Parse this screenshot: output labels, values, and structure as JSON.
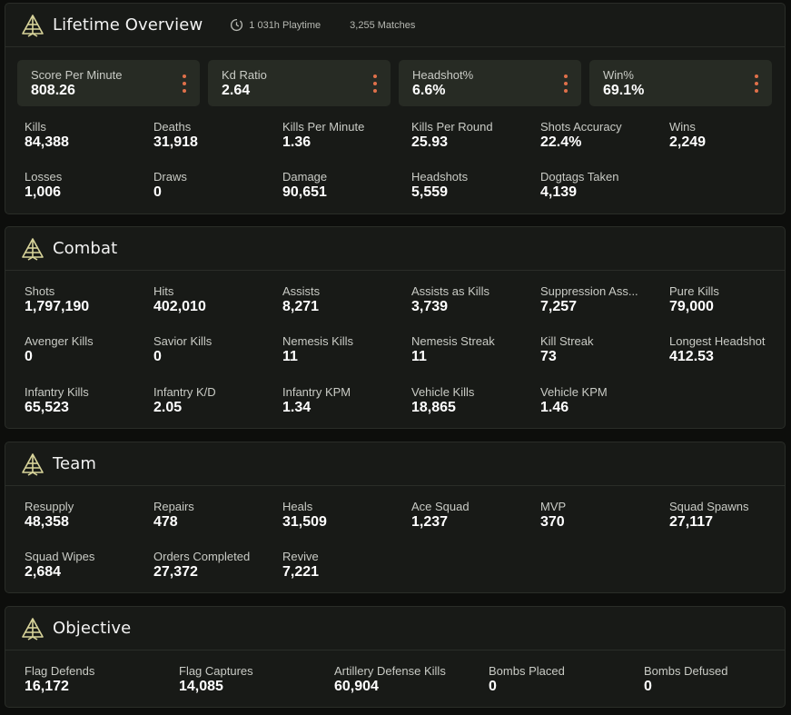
{
  "lifetime": {
    "title": "Lifetime Overview",
    "playtime": "1 031h Playtime",
    "matches": "3,255 Matches",
    "highlights": [
      {
        "label": "Score Per Minute",
        "value": "808.26"
      },
      {
        "label": "Kd Ratio",
        "value": "2.64"
      },
      {
        "label": "Headshot%",
        "value": "6.6%"
      },
      {
        "label": "Win%",
        "value": "69.1%"
      }
    ],
    "stats": [
      {
        "label": "Kills",
        "value": "84,388"
      },
      {
        "label": "Deaths",
        "value": "31,918"
      },
      {
        "label": "Kills Per Minute",
        "value": "1.36"
      },
      {
        "label": "Kills Per Round",
        "value": "25.93"
      },
      {
        "label": "Shots Accuracy",
        "value": "22.4%"
      },
      {
        "label": "Wins",
        "value": "2,249"
      },
      {
        "label": "Losses",
        "value": "1,006"
      },
      {
        "label": "Draws",
        "value": "0"
      },
      {
        "label": "Damage",
        "value": "90,651"
      },
      {
        "label": "Headshots",
        "value": "5,559"
      },
      {
        "label": "Dogtags Taken",
        "value": "4,139"
      }
    ]
  },
  "combat": {
    "title": "Combat",
    "stats": [
      {
        "label": "Shots",
        "value": "1,797,190"
      },
      {
        "label": "Hits",
        "value": "402,010"
      },
      {
        "label": "Assists",
        "value": "8,271"
      },
      {
        "label": "Assists as Kills",
        "value": "3,739"
      },
      {
        "label": "Suppression Ass...",
        "value": "7,257"
      },
      {
        "label": "Pure Kills",
        "value": "79,000"
      },
      {
        "label": "Avenger Kills",
        "value": "0"
      },
      {
        "label": "Savior Kills",
        "value": "0"
      },
      {
        "label": "Nemesis Kills",
        "value": "11"
      },
      {
        "label": "Nemesis Streak",
        "value": "11"
      },
      {
        "label": "Kill Streak",
        "value": "73"
      },
      {
        "label": "Longest Headshot",
        "value": "412.53"
      },
      {
        "label": "Infantry Kills",
        "value": "65,523"
      },
      {
        "label": "Infantry K/D",
        "value": "2.05"
      },
      {
        "label": "Infantry KPM",
        "value": "1.34"
      },
      {
        "label": "Vehicle Kills",
        "value": "18,865"
      },
      {
        "label": "Vehicle KPM",
        "value": "1.46"
      }
    ]
  },
  "team": {
    "title": "Team",
    "stats": [
      {
        "label": "Resupply",
        "value": "48,358"
      },
      {
        "label": "Repairs",
        "value": "478"
      },
      {
        "label": "Heals",
        "value": "31,509"
      },
      {
        "label": "Ace Squad",
        "value": "1,237"
      },
      {
        "label": "MVP",
        "value": "370"
      },
      {
        "label": "Squad Spawns",
        "value": "27,117"
      },
      {
        "label": "Squad Wipes",
        "value": "2,684"
      },
      {
        "label": "Orders Completed",
        "value": "27,372"
      },
      {
        "label": "Revive",
        "value": "7,221"
      }
    ]
  },
  "objective": {
    "title": "Objective",
    "stats": [
      {
        "label": "Flag Defends",
        "value": "16,172"
      },
      {
        "label": "Flag Captures",
        "value": "14,085"
      },
      {
        "label": "Artillery Defense Kills",
        "value": "60,904"
      },
      {
        "label": "Bombs Placed",
        "value": "0"
      },
      {
        "label": "Bombs Defused",
        "value": "0"
      }
    ]
  },
  "colors": {
    "accent": "#e0704a",
    "icon": "#d8d49a",
    "panel": "#181a17",
    "card": "#272b24"
  },
  "icons": {
    "section": "pyramid-logo-icon",
    "playtime": "clock-icon",
    "menu": "kebab-menu-icon"
  }
}
